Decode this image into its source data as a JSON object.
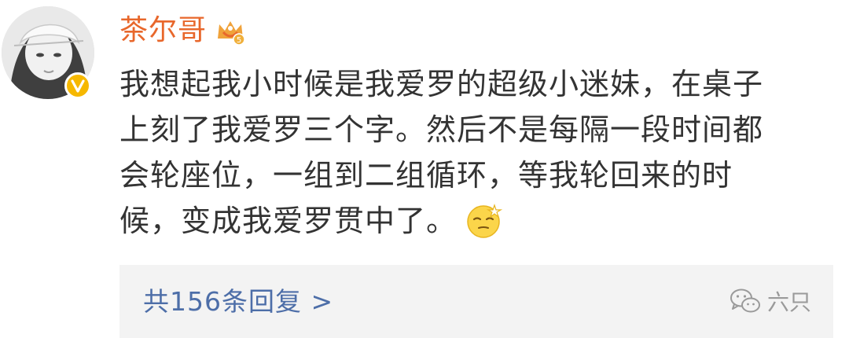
{
  "post": {
    "username": "茶尔哥",
    "comment_lines": [
      "我想起我小时候是我爱罗的超级小迷妹，在桌子",
      "上刻了我爱罗三个字。然后不是每隔一段时间都",
      "会轮座位，一组到二组循环，等我轮回来的时",
      "候，变成我爱罗贯中了。"
    ],
    "emoji": "sweat-smile-emoji"
  },
  "replies": {
    "label": "共156条回复 >"
  },
  "watermark": {
    "text": "六只"
  },
  "colors": {
    "username": "#e8672b",
    "link": "#4d6ea8",
    "verified": "#f6b800"
  }
}
